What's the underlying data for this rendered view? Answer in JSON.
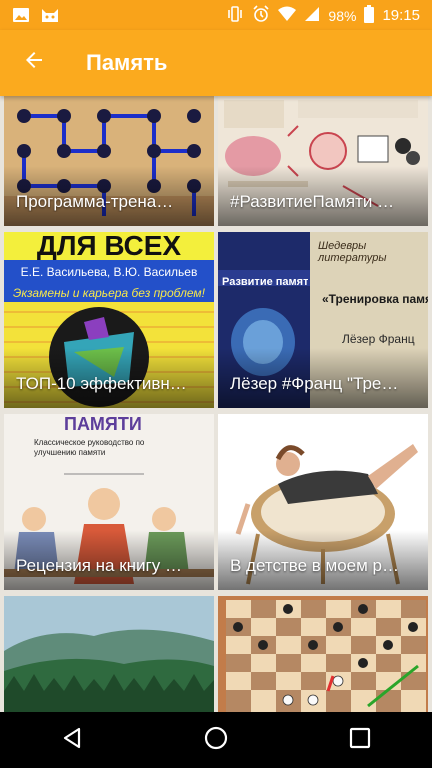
{
  "status_bar": {
    "battery": "98%",
    "time": "19:15",
    "icons": [
      "image-icon",
      "cat-icon",
      "vibrate-icon",
      "alarm-icon",
      "wifi-icon",
      "signal-icon",
      "battery-icon"
    ]
  },
  "app_bar": {
    "title": "Память",
    "back_icon": "arrow-back-icon",
    "color": "#fbaa1e"
  },
  "cards": [
    {
      "caption": "Программа-трена…"
    },
    {
      "caption": "#РазвитиеПамяти …"
    },
    {
      "caption": "ТОП-10 эффективн…",
      "cover_title": "ДЛЯ ВСЕХ",
      "cover_authors": "Е.Е. Васильева, В.Ю. Васильев",
      "cover_subtitle": "Экзамены и карьера без проблем!"
    },
    {
      "caption": "Лёзер #Франц \"Тре…",
      "cover_series": "Шедевры литературы",
      "cover_label": "Развитие памяти",
      "cover_book_title": "«Тренировка памят",
      "cover_author": "Лёзер Франц"
    },
    {
      "caption": "Рецензия на книгу …",
      "cover_title": "ПАМЯТИ",
      "cover_subtitle": "Классическое руководство по улучшению памяти"
    },
    {
      "caption": "В детстве в моем р…"
    },
    {
      "caption": ""
    },
    {
      "caption": ""
    }
  ],
  "nav_bar": {
    "icons": [
      "back-triangle-icon",
      "home-circle-icon",
      "recents-square-icon"
    ]
  }
}
